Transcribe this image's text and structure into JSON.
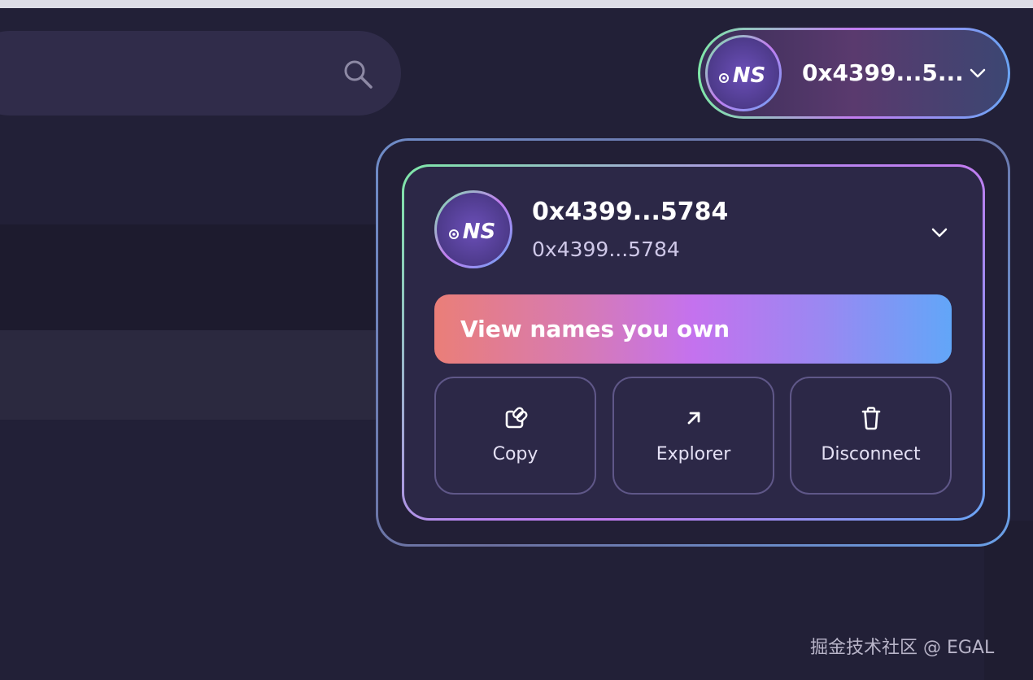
{
  "search": {
    "icon": "search-icon"
  },
  "wallet": {
    "avatar_icon": "ns-logo-icon",
    "avatar_text": "NS",
    "address_short": "0x4399...5...",
    "chevron_icon": "chevron-down-icon"
  },
  "dropdown": {
    "primary_name": "0x4399...5784",
    "address": "0x4399...5784",
    "chevron_icon": "chevron-down-icon",
    "view_names_label": "View names you own",
    "actions": [
      {
        "label": "Copy",
        "icon": "copy-link-icon"
      },
      {
        "label": "Explorer",
        "icon": "arrow-up-right-icon"
      },
      {
        "label": "Disconnect",
        "icon": "trash-icon"
      }
    ]
  },
  "watermark": {
    "text": "掘金技术社区 @ EGAL"
  },
  "colors": {
    "background": "#222037",
    "search_bar": "#302c4a",
    "card": "#2c2847",
    "gradient_green": "#7ee8a8",
    "gradient_purple": "#c27cf0",
    "gradient_blue": "#6aa4f4",
    "gradient_salmon": "#ea7e78"
  }
}
